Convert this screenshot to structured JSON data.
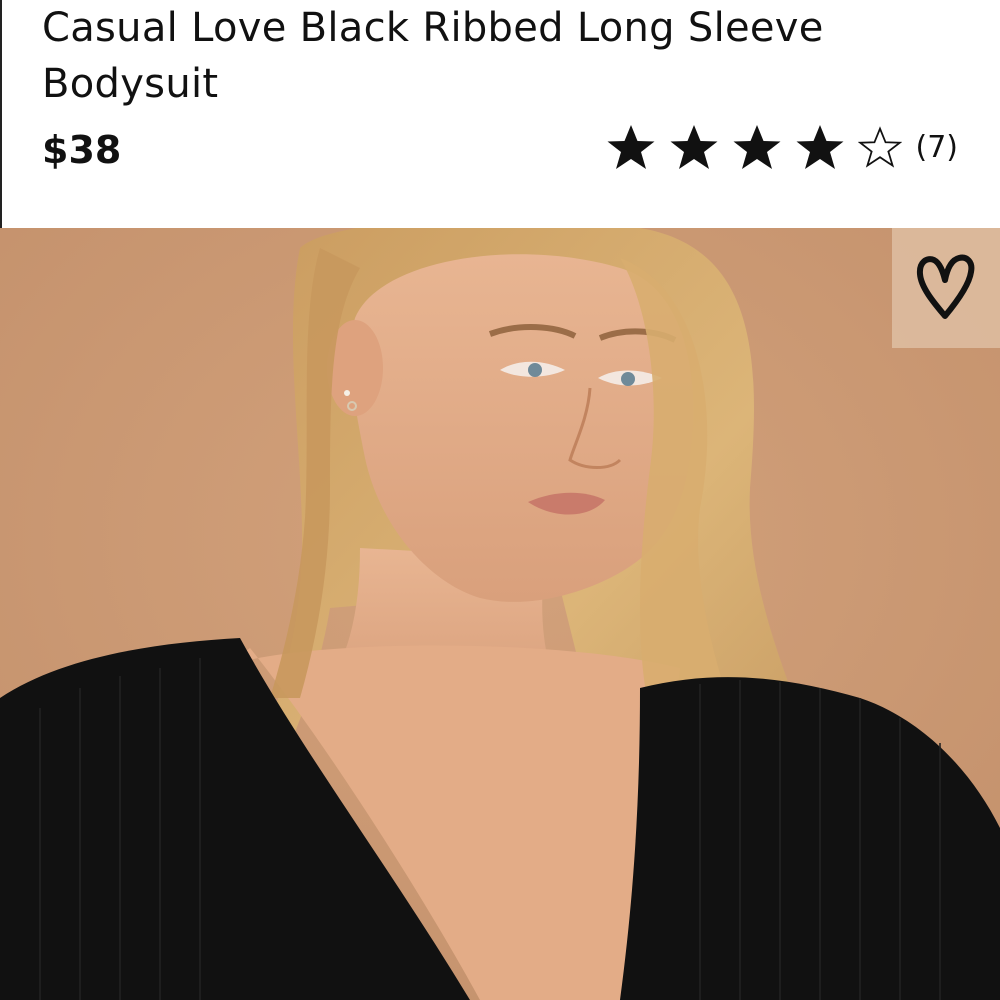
{
  "product": {
    "title": "Casual Love Black Ribbed Long Sleeve Bodysuit",
    "price": "$38",
    "rating": {
      "value": 4,
      "max": 5,
      "review_count": "(7)"
    }
  },
  "image": {
    "alt": "Model wearing black ribbed long sleeve bodysuit",
    "background_color": "#cb9a74"
  },
  "icons": {
    "wishlist": "heart-icon",
    "star_filled": "star-filled-icon",
    "star_empty": "star-outline-icon"
  }
}
